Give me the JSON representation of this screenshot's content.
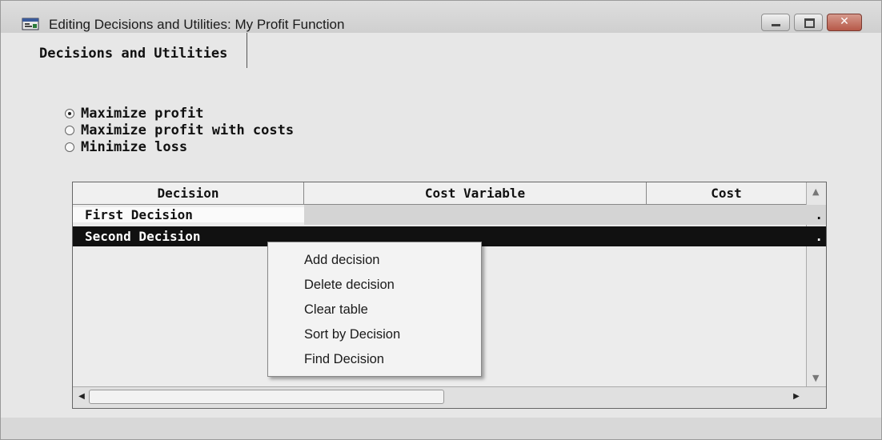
{
  "window": {
    "title": "Editing Decisions and Utilities: My Profit Function",
    "controls": [
      "minimize",
      "maximize",
      "close"
    ]
  },
  "tabs": [
    {
      "label": "Decisions and Utilities",
      "active": true
    }
  ],
  "objective": {
    "options": [
      {
        "label": "Maximize profit",
        "checked": true
      },
      {
        "label": "Maximize profit with costs",
        "checked": false
      },
      {
        "label": "Minimize loss",
        "checked": false
      }
    ]
  },
  "table": {
    "columns": [
      "Decision",
      "Cost Variable",
      "Cost"
    ],
    "rows": [
      {
        "decision": "First Decision",
        "cost_variable": "",
        "cost": ".",
        "selected": false
      },
      {
        "decision": "Second Decision",
        "cost_variable": "",
        "cost": ".",
        "selected": true
      }
    ]
  },
  "context_menu": {
    "items": [
      "Add decision",
      "Delete decision",
      "Clear table",
      "Sort by Decision",
      "Find Decision"
    ]
  },
  "icons": {
    "app": "app-window-icon",
    "scroll_up": "scroll-up-arrow-icon",
    "scroll_down": "scroll-down-arrow-icon",
    "scroll_left": "scroll-left-arrow-icon",
    "scroll_right": "scroll-right-arrow-icon"
  },
  "colors": {
    "selection_bg": "#111111",
    "selection_fg": "#ffffff",
    "window_bg": "#e7e7e7",
    "close_button": "#b65848"
  }
}
